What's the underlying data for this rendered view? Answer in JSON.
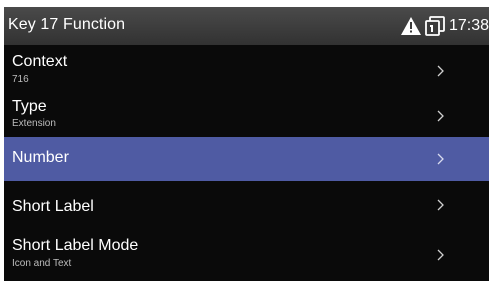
{
  "header": {
    "title": "Key 17 Function",
    "time": "17:38",
    "icons": [
      "warning-icon",
      "mobile-device-icon"
    ]
  },
  "menu": {
    "items": [
      {
        "label": "Context",
        "value": "716",
        "icon": "chevron-right-icon"
      },
      {
        "label": "Type",
        "value": "Extension",
        "icon": "chevron-right-icon"
      },
      {
        "label": "Number",
        "value": "",
        "icon": "chevron-right-icon",
        "selected": true
      },
      {
        "label": "Short Label",
        "value": "",
        "icon": "chevron-right-icon"
      },
      {
        "label": "Short Label Mode",
        "value": "Icon and Text",
        "icon": "chevron-right-icon"
      }
    ]
  },
  "colors": {
    "background": "#0a0a0a",
    "header": "#3c3c3c",
    "selection": "#4f5ba3",
    "text": "#ffffff",
    "subtext": "#bdbdbd"
  }
}
